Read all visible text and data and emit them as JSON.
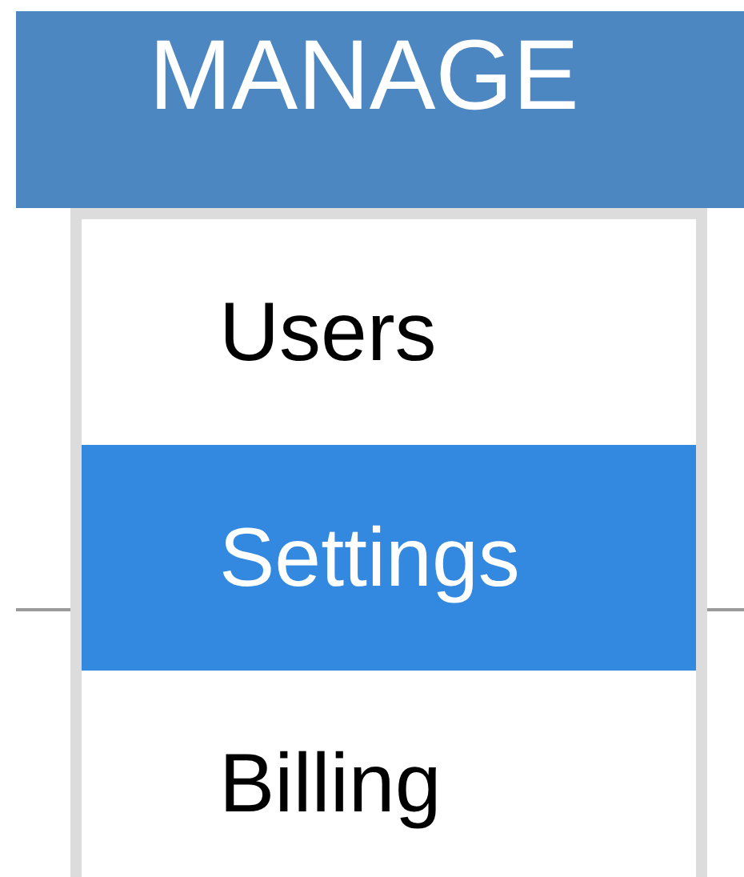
{
  "header": {
    "title": "MANAGE"
  },
  "menu": [
    {
      "label": "Users",
      "selected": false
    },
    {
      "label": "Settings",
      "selected": true
    },
    {
      "label": "Billing",
      "selected": false
    }
  ]
}
